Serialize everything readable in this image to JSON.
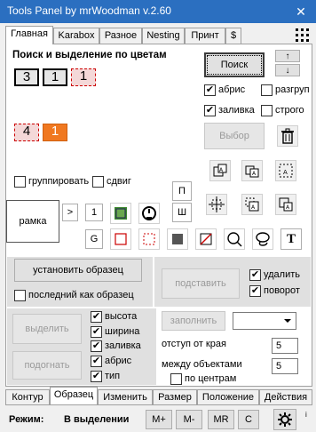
{
  "window": {
    "title": "Tools Panel by mrWoodman v.2.60",
    "close": "✕"
  },
  "tabs": [
    "Главная",
    "Karabox",
    "Разное",
    "Nesting",
    "Принт",
    "$"
  ],
  "color_search": {
    "heading": "Поиск и выделение по цветам",
    "nums": [
      "3",
      "1",
      "1",
      "4",
      "1"
    ],
    "search_label": "Поиск",
    "up": "↑",
    "down": "↓",
    "abris": "абрис",
    "razgroup": "разгруп",
    "zalivka": "заливка",
    "strogo": "строго",
    "select_label": "Выбор"
  },
  "group": {
    "group_label": "группировать",
    "shift_label": "сдвиг"
  },
  "frame": {
    "label": "рамка",
    "gt": ">",
    "one": "1",
    "p": "П",
    "sh": "Ш",
    "g": "G",
    "t": "T"
  },
  "sample": {
    "set_label": "установить образец",
    "last_label": "последний как образец",
    "substitute_label": "подставить",
    "delete_label": "удалить",
    "rotate_label": "поворот"
  },
  "select_panel": {
    "select_label": "выделить",
    "fit_label": "подогнать",
    "height": "высота",
    "width": "ширина",
    "fill": "заливка",
    "outline": "абрис",
    "type": "тип"
  },
  "fill_panel": {
    "fill_label": "заполнить",
    "edge_label": "отступ от края",
    "edge_value": "5",
    "between_label": "между объектами",
    "between_value": "5",
    "center_label": "по центрам"
  },
  "bottom_tabs": [
    "Контур",
    "Образец",
    "Изменить",
    "Размер",
    "Положение",
    "Действия"
  ],
  "status": {
    "mode_label": "Режим:",
    "mode_value": "В выделении",
    "mplus": "M+",
    "mminus": "M-",
    "mr": "MR",
    "c": "C"
  },
  "colors": {
    "accent": "#2b6fc0",
    "orange": "#f07820",
    "green": "#3d8a2e"
  }
}
